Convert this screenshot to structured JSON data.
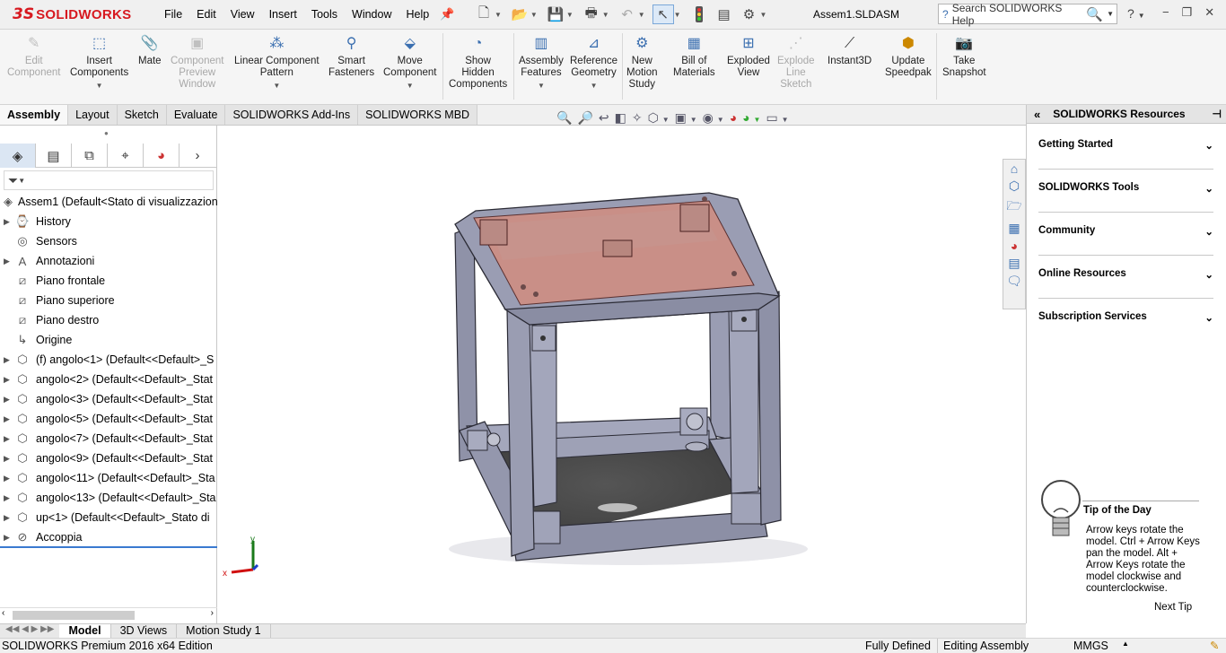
{
  "app": {
    "brand_ds": "3S",
    "brand_name": "SOLIDWORKS",
    "document_title": "Assem1.SLDASM"
  },
  "menu": [
    "File",
    "Edit",
    "View",
    "Insert",
    "Tools",
    "Window",
    "Help"
  ],
  "search": {
    "placeholder": "Search SOLIDWORKS Help"
  },
  "ribbon": [
    {
      "label": "Edit\nComponent",
      "icon": "edit-component-icon",
      "disabled": true
    },
    {
      "label": "Insert\nComponents",
      "icon": "insert-components-icon",
      "disabled": false
    },
    {
      "label": "Mate",
      "icon": "mate-paperclip-icon",
      "disabled": false
    },
    {
      "label": "Component\nPreview\nWindow",
      "icon": "preview-window-icon",
      "disabled": true
    },
    {
      "label": "Linear Component\nPattern",
      "icon": "linear-pattern-icon",
      "disabled": false
    },
    {
      "label": "Smart\nFasteners",
      "icon": "smart-fasteners-icon",
      "disabled": false
    },
    {
      "label": "Move\nComponent",
      "icon": "move-component-icon",
      "disabled": false
    },
    {
      "label": "Show\nHidden\nComponents",
      "icon": "show-hidden-icon",
      "disabled": false
    },
    {
      "label": "Assembly\nFeatures",
      "icon": "assembly-features-icon",
      "disabled": false
    },
    {
      "label": "Reference\nGeometry",
      "icon": "reference-geometry-icon",
      "disabled": false
    },
    {
      "label": "New\nMotion\nStudy",
      "icon": "motion-study-icon",
      "disabled": false
    },
    {
      "label": "Bill of\nMaterials",
      "icon": "bill-of-materials-icon",
      "disabled": false
    },
    {
      "label": "Exploded\nView",
      "icon": "exploded-view-icon",
      "disabled": false
    },
    {
      "label": "Explode\nLine\nSketch",
      "icon": "explode-line-sketch-icon",
      "disabled": true
    },
    {
      "label": "Instant3D",
      "icon": "instant3d-icon",
      "disabled": false
    },
    {
      "label": "Update\nSpeedpak",
      "icon": "update-speedpak-icon",
      "disabled": false
    },
    {
      "label": "Take\nSnapshot",
      "icon": "camera-icon",
      "disabled": false
    }
  ],
  "tabs": [
    "Assembly",
    "Layout",
    "Sketch",
    "Evaluate",
    "SOLIDWORKS Add-Ins",
    "SOLIDWORKS MBD"
  ],
  "active_tab": "Assembly",
  "tree": [
    {
      "label": "Assem1  (Default<Stato di visualizzazione",
      "icon": "assembly-icon",
      "expander": false,
      "root": true
    },
    {
      "label": "History",
      "icon": "history-icon",
      "expander": true
    },
    {
      "label": "Sensors",
      "icon": "sensors-icon",
      "expander": false
    },
    {
      "label": "Annotazioni",
      "icon": "annotation-icon",
      "expander": true
    },
    {
      "label": "Piano frontale",
      "icon": "plane-icon",
      "expander": false
    },
    {
      "label": "Piano superiore",
      "icon": "plane-icon",
      "expander": false
    },
    {
      "label": "Piano destro",
      "icon": "plane-icon",
      "expander": false
    },
    {
      "label": "Origine",
      "icon": "origin-icon",
      "expander": false
    },
    {
      "label": "(f) angolo<1> (Default<<Default>_S",
      "icon": "part-icon",
      "expander": true
    },
    {
      "label": "angolo<2> (Default<<Default>_Stat",
      "icon": "part-icon",
      "expander": true
    },
    {
      "label": "angolo<3> (Default<<Default>_Stat",
      "icon": "part-icon",
      "expander": true
    },
    {
      "label": "angolo<5> (Default<<Default>_Stat",
      "icon": "part-icon",
      "expander": true
    },
    {
      "label": "angolo<7> (Default<<Default>_Stat",
      "icon": "part-icon",
      "expander": true
    },
    {
      "label": "angolo<9> (Default<<Default>_Stat",
      "icon": "part-icon",
      "expander": true
    },
    {
      "label": "angolo<11> (Default<<Default>_Sta",
      "icon": "part-icon",
      "expander": true
    },
    {
      "label": "angolo<13> (Default<<Default>_Sta",
      "icon": "part-icon",
      "expander": true
    },
    {
      "label": "up<1> (Default<<Default>_Stato di",
      "icon": "part-icon",
      "expander": true
    },
    {
      "label": "Accoppia",
      "icon": "mates-icon",
      "expander": true
    }
  ],
  "resources": {
    "title": "SOLIDWORKS Resources",
    "sections": [
      "Getting Started",
      "SOLIDWORKS Tools",
      "Community",
      "Online Resources",
      "Subscription Services"
    ],
    "tip_title": "Tip of the Day",
    "tip_text": "Arrow keys rotate the model. Ctrl + Arrow Keys pan the model. Alt + Arrow Keys rotate the model clockwise and counterclockwise.",
    "next_tip": "Next Tip"
  },
  "bottom_tabs": [
    "Model",
    "3D Views",
    "Motion Study 1"
  ],
  "status": {
    "edition": "SOLIDWORKS Premium 2016 x64 Edition",
    "state": "Fully Defined",
    "mode": "Editing Assembly",
    "units": "MMGS"
  },
  "triad": {
    "x": "x",
    "y": "y"
  },
  "colors": {
    "frame": "#9497ad",
    "top_panel": "#c98f87",
    "floor": "#4d4d4d"
  }
}
